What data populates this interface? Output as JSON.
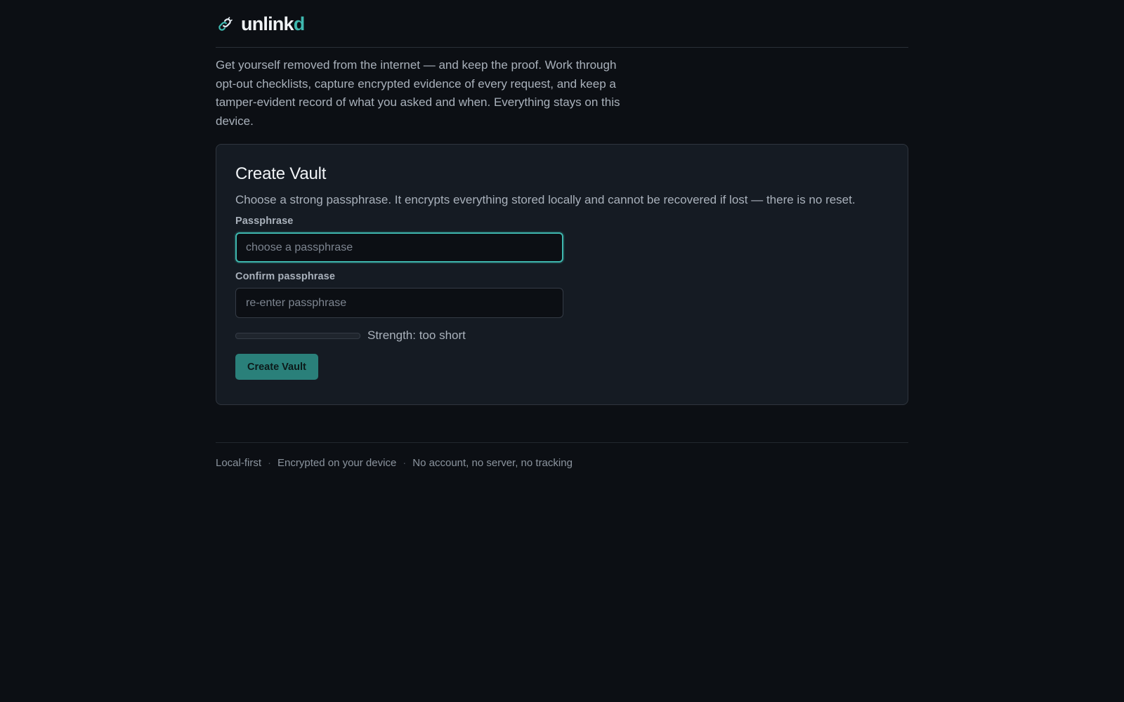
{
  "app": {
    "brand_main": "unlink",
    "brand_accent": "d",
    "logo_icon": "link-icon",
    "accent_color": "#3fb9b0"
  },
  "intro": {
    "text": "Get yourself removed from the internet — and keep the proof. Work through opt-out checklists, capture encrypted evidence of every request, and keep a tamper-evident record of what you asked and when. Everything stays on this device."
  },
  "create_vault": {
    "title": "Create Vault",
    "description": "Choose a strong passphrase. It encrypts everything stored locally and cannot be recovered if lost — there is no reset.",
    "passphrase": {
      "label": "Passphrase",
      "placeholder": "choose a passphrase",
      "value": ""
    },
    "confirm": {
      "label": "Confirm passphrase",
      "placeholder": "re-enter passphrase",
      "value": ""
    },
    "strength": {
      "text": "Strength: too short",
      "level": 0
    },
    "submit_label": "Create Vault"
  },
  "footer": {
    "items": [
      "Local-first",
      "Encrypted on your device",
      "No account, no server, no tracking"
    ],
    "separator": "·"
  }
}
